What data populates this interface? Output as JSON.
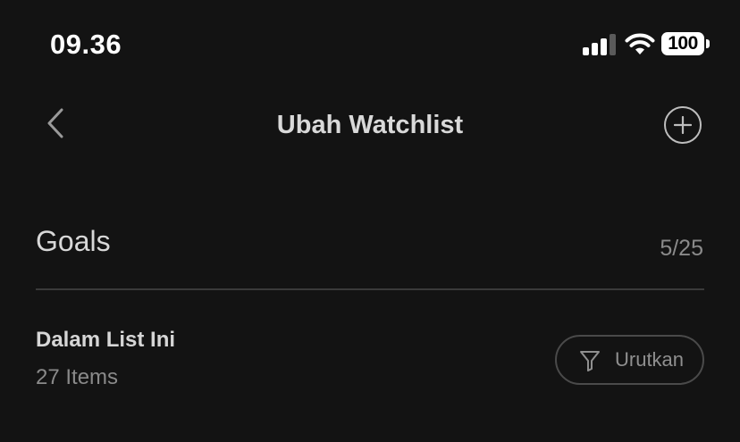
{
  "status_bar": {
    "time": "09.36",
    "battery_level": "100",
    "signal_icon": "cellular-signal-icon",
    "wifi_icon": "wifi-icon"
  },
  "nav": {
    "back_icon": "chevron-left-icon",
    "title": "Ubah Watchlist",
    "add_icon": "plus-circle-icon"
  },
  "watchlist": {
    "name": "Goals",
    "char_count": "5/25"
  },
  "section": {
    "title": "Dalam List Ini",
    "count": "27 Items",
    "sort_label": "Urutkan",
    "sort_icon": "filter-icon"
  },
  "colors": {
    "background": "#131313",
    "text_primary": "#d8d8d8",
    "text_secondary": "#8a8a8a",
    "divider": "#3a3a3a"
  }
}
